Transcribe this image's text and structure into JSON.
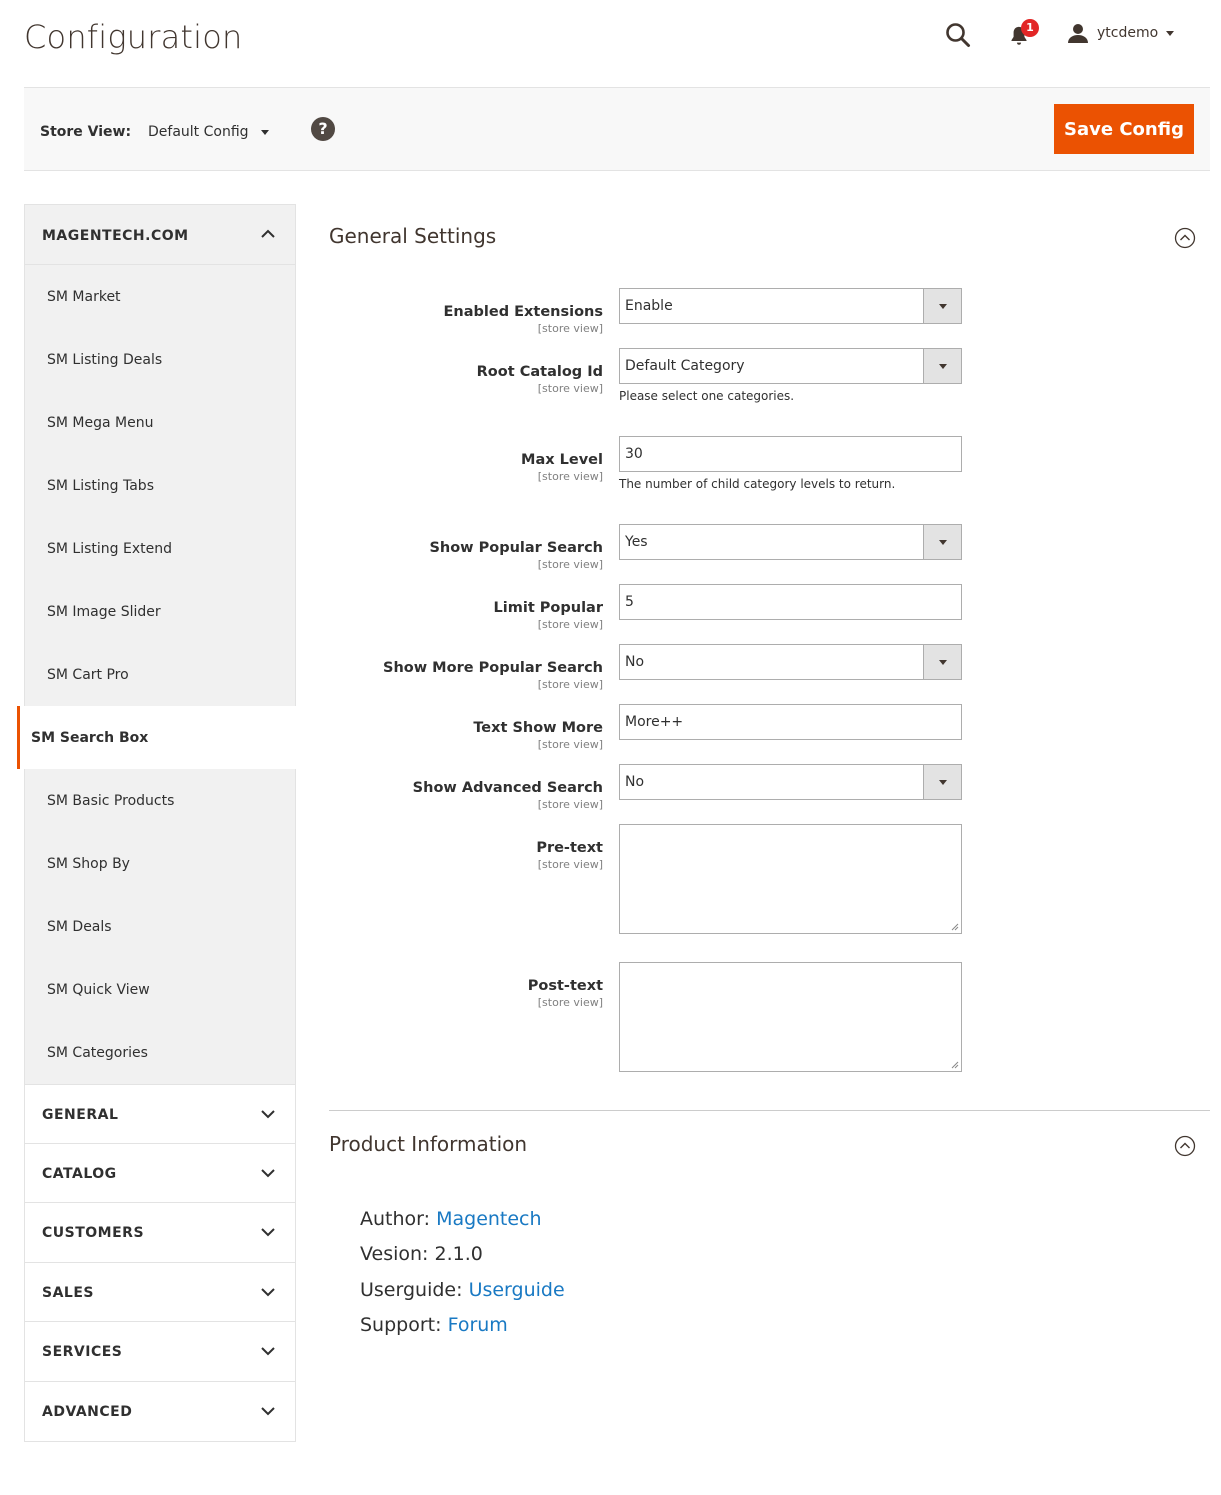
{
  "header": {
    "title": "Configuration",
    "notifications_count": "1",
    "username": "ytcdemo"
  },
  "store_bar": {
    "label": "Store View:",
    "selected": "Default Config",
    "help": "?",
    "save_label": "Save Config"
  },
  "colors": {
    "accent": "#eb5202",
    "link": "#1979c3",
    "badge": "#e22626"
  },
  "sidebar": {
    "open_section": "MAGENTECH.COM",
    "items": [
      {
        "label": "SM Market"
      },
      {
        "label": "SM Listing Deals"
      },
      {
        "label": "SM Mega Menu"
      },
      {
        "label": "SM Listing Tabs"
      },
      {
        "label": "SM Listing Extend"
      },
      {
        "label": "SM Image Slider"
      },
      {
        "label": "SM Cart Pro"
      },
      {
        "label": "SM Search Box",
        "active": true
      },
      {
        "label": "SM Basic Products"
      },
      {
        "label": "SM Shop By"
      },
      {
        "label": "SM Deals"
      },
      {
        "label": "SM Quick View"
      },
      {
        "label": "SM Categories"
      }
    ],
    "sections": [
      "GENERAL",
      "CATALOG",
      "CUSTOMERS",
      "SALES",
      "SERVICES",
      "ADVANCED"
    ]
  },
  "general": {
    "title": "General Settings",
    "scope": "[store view]",
    "fields": [
      {
        "label": "Enabled Extensions",
        "value": "Enable"
      },
      {
        "label": "Root Catalog Id",
        "value": "Default Category",
        "note": "Please select one categories."
      },
      {
        "label": "Max Level",
        "value": "30",
        "note": "The number of child category levels to return."
      },
      {
        "label": "Show Popular Search",
        "value": "Yes"
      },
      {
        "label": "Limit Popular",
        "value": "5"
      },
      {
        "label": "Show More Popular Search",
        "value": "No"
      },
      {
        "label": "Text Show More",
        "value": "More++"
      },
      {
        "label": "Show Advanced Search",
        "value": "No"
      },
      {
        "label": "Pre-text",
        "value": ""
      },
      {
        "label": "Post-text",
        "value": ""
      }
    ]
  },
  "product_info": {
    "title": "Product Information",
    "author_label": "Author:",
    "author_link": "Magentech",
    "version_label": "Vesion:",
    "version": "2.1.0",
    "guide_label": "Userguide:",
    "guide_link": "Userguide",
    "support_label": "Support:",
    "support_link": "Forum"
  }
}
